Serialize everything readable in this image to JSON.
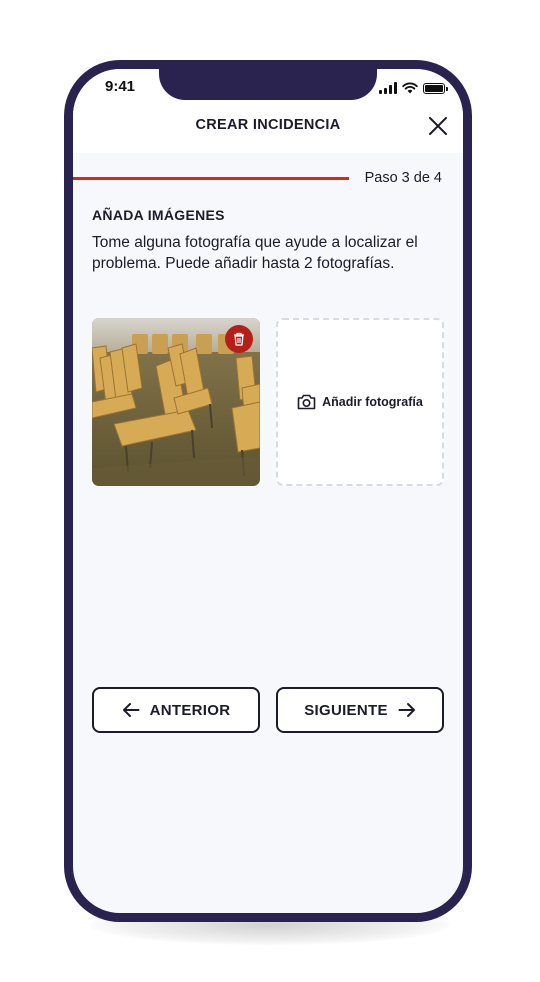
{
  "status_bar": {
    "time": "9:41"
  },
  "header": {
    "title": "CREAR INCIDENCIA",
    "close_icon": "close-icon"
  },
  "progress": {
    "label": "Paso 3 de 4",
    "current_step": 3,
    "total_steps": 4
  },
  "section": {
    "title": "AÑADA IMÁGENES",
    "description": "Tome alguna fotografía que ayude a localizar el problema. Puede añadir hasta 2 fotografías."
  },
  "photos": {
    "add_label": "Añadir fotografía",
    "delete_icon": "trash-icon",
    "add_icon": "camera-icon"
  },
  "navigation": {
    "previous_label": "ANTERIOR",
    "next_label": "SIGUIENTE"
  },
  "colors": {
    "frame": "#2a2350",
    "accent": "#d4271f",
    "delete": "#b51f1a",
    "text": "#1b1b2a",
    "background": "#f7f8fc"
  }
}
